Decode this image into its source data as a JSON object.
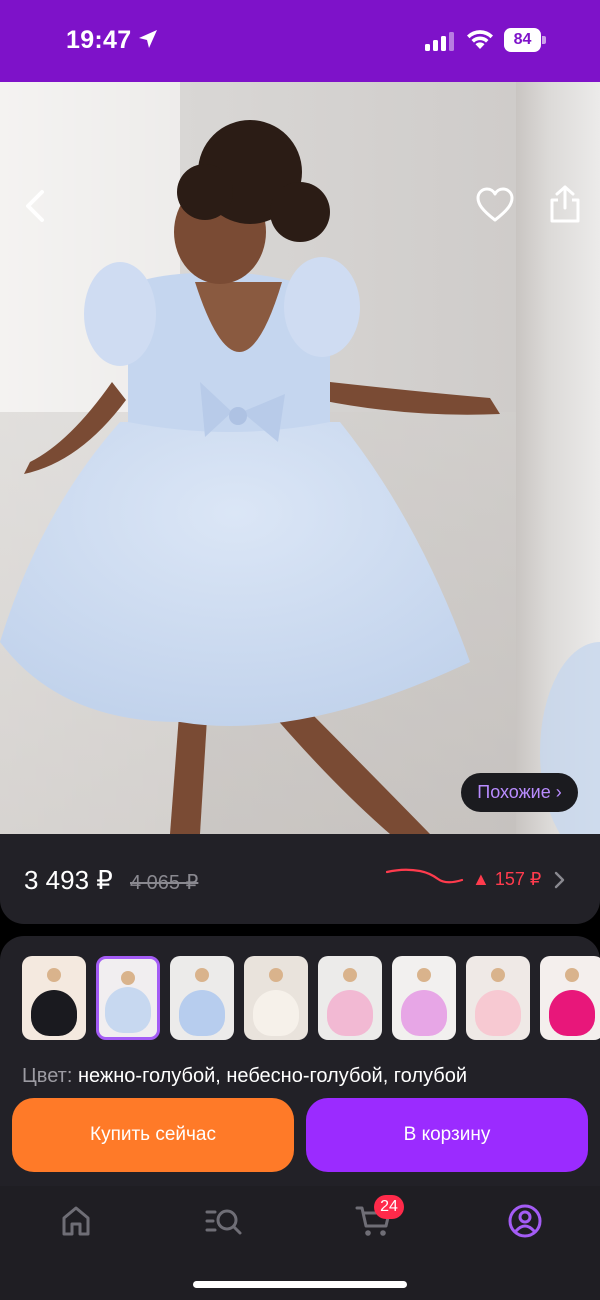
{
  "status_bar": {
    "time": "19:47",
    "battery": "84",
    "icons": [
      "location-arrow-icon",
      "signal-icon",
      "wifi-icon",
      "battery-icon"
    ]
  },
  "product": {
    "similar_label": "Похожие ›",
    "price_current": "3 493 ₽",
    "price_old": "4 065 ₽",
    "price_change": "▲ 157 ₽",
    "variants": [
      {
        "colors": [
          "#1a1a1f",
          "#f4e9df"
        ],
        "selected": false
      },
      {
        "colors": [
          "#c7d8f0",
          "#f1eef0"
        ],
        "selected": true
      },
      {
        "colors": [
          "#b7cdee",
          "#ecebea"
        ],
        "selected": false
      },
      {
        "colors": [
          "#f6f1ea",
          "#e9e3dc"
        ],
        "selected": false
      },
      {
        "colors": [
          "#f2b9d3",
          "#ecebea"
        ],
        "selected": false
      },
      {
        "colors": [
          "#e7a6e6",
          "#f2f0ef"
        ],
        "selected": false
      },
      {
        "colors": [
          "#f7c9d2",
          "#efe9e6"
        ],
        "selected": false
      },
      {
        "colors": [
          "#e8177a",
          "#f4efed"
        ],
        "selected": false
      }
    ],
    "color_label": "Цвет:",
    "color_value": "нежно-голубой, небесно-голубой, голубой"
  },
  "actions": {
    "buy_now": "Купить сейчас",
    "add_to_cart": "В корзину"
  },
  "tab_bar": {
    "items": [
      "home-icon",
      "catalog-search-icon",
      "cart-icon",
      "profile-icon"
    ],
    "active": "profile-icon",
    "cart_badge": "24"
  },
  "colors": {
    "brand_purple": "#7e12c9",
    "buy_orange": "#ff7a28",
    "cart_purple": "#9b2bff",
    "price_up_red": "#ff3b4d",
    "card_bg": "#222127"
  }
}
